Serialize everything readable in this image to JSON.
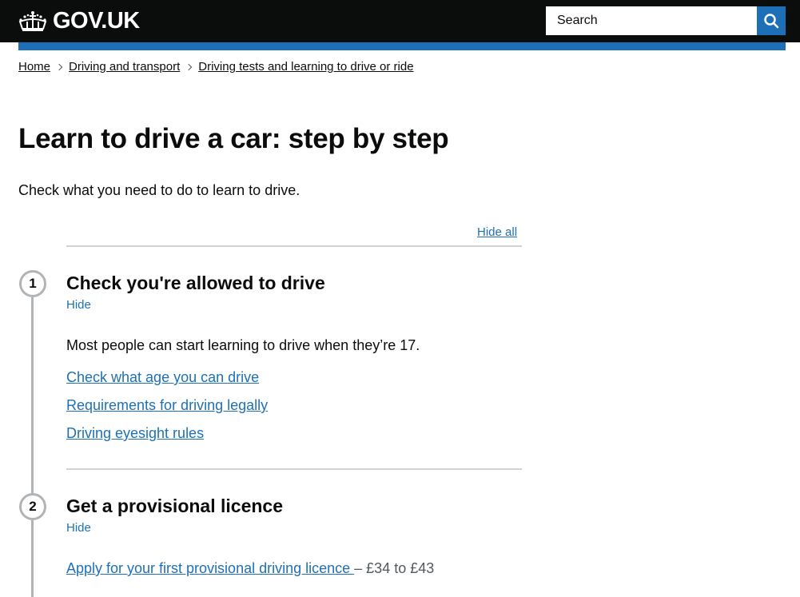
{
  "header": {
    "logo_text": "GOV.UK",
    "search": {
      "placeholder": "Search",
      "value": ""
    },
    "brand_color": "#1d70b8"
  },
  "breadcrumbs": [
    {
      "label": "Home"
    },
    {
      "label": "Driving and transport"
    },
    {
      "label": "Driving tests and learning to drive or ride"
    }
  ],
  "page": {
    "title": "Learn to drive a car: step by step",
    "lede": "Check what you need to do to learn to drive.",
    "hide_all_label": "Hide all"
  },
  "steps": [
    {
      "number": "1",
      "title": "Check you're allowed to drive",
      "toggle_label": "Hide",
      "paragraph": "Most people can start learning to drive when they’re 17.",
      "links": [
        {
          "label": "Check what age you can drive"
        },
        {
          "label": "Requirements for driving legally"
        },
        {
          "label": "Driving eyesight rules"
        }
      ]
    },
    {
      "number": "2",
      "title": "Get a provisional licence",
      "toggle_label": "Hide",
      "links": [
        {
          "label": "Apply for your first provisional driving licence ",
          "cost": "– £34 to £43"
        }
      ]
    }
  ]
}
